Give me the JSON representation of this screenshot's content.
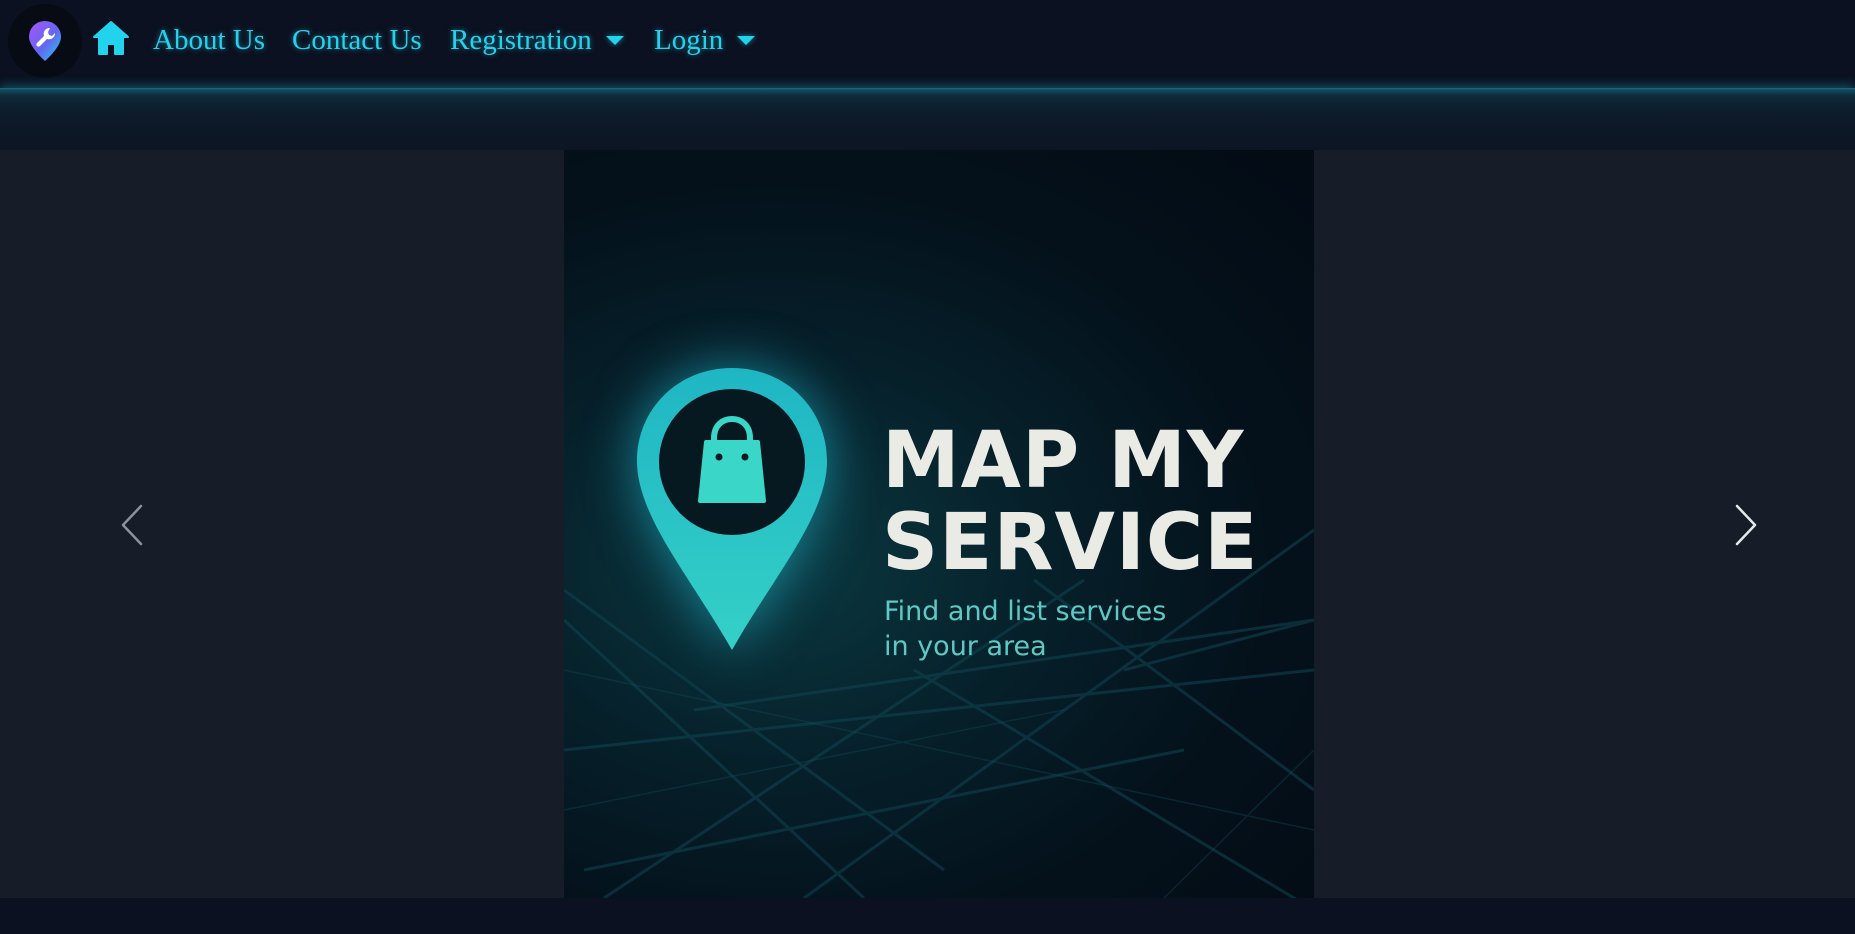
{
  "navbar": {
    "logo_icon": "wrench-location-pin-icon",
    "home_icon": "home-icon",
    "links": [
      {
        "label": "About Us"
      },
      {
        "label": "Contact Us"
      },
      {
        "label": "Registration",
        "dropdown": true
      },
      {
        "label": "Login",
        "dropdown": true
      }
    ],
    "link_color": "#22d3ee"
  },
  "carousel": {
    "prev_icon": "chevron-left-icon",
    "next_icon": "chevron-right-icon",
    "slide": {
      "icon": "shopping-bag-location-pin-icon",
      "title_line1": "MAP MY",
      "title_line2": "SERVICE",
      "subtitle_line1": "Find and list services",
      "subtitle_line2": "in your area"
    }
  },
  "colors": {
    "background": "#0b1120",
    "accent": "#22d3ee",
    "pin": "#2cc5c8",
    "title": "#ebebe6",
    "subtitle": "#5ec9c4"
  }
}
